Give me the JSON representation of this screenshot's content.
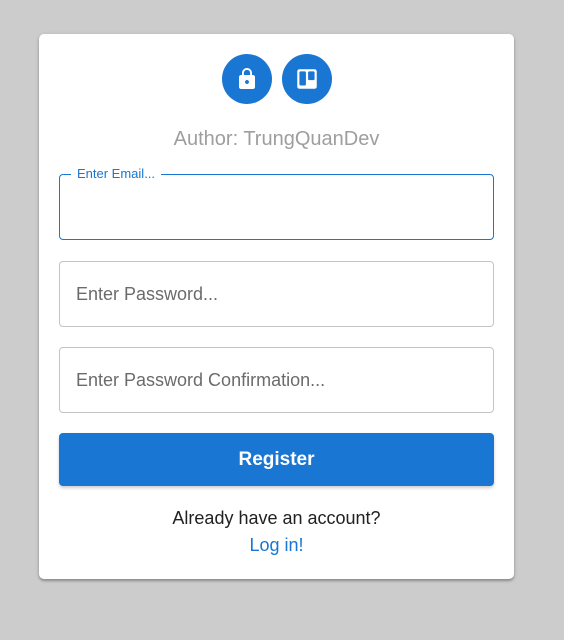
{
  "icons": {
    "lock": "lock-icon",
    "trello": "trello-icon",
    "accent_color": "#1976d2"
  },
  "author": "Author: TrungQuanDev",
  "form": {
    "email": {
      "label": "Enter Email...",
      "value": ""
    },
    "password": {
      "placeholder": "Enter Password...",
      "value": ""
    },
    "password_confirmation": {
      "placeholder": "Enter Password Confirmation...",
      "value": ""
    },
    "submit_label": "Register"
  },
  "footer": {
    "prompt": "Already have an account?",
    "login_link": "Log in!"
  }
}
